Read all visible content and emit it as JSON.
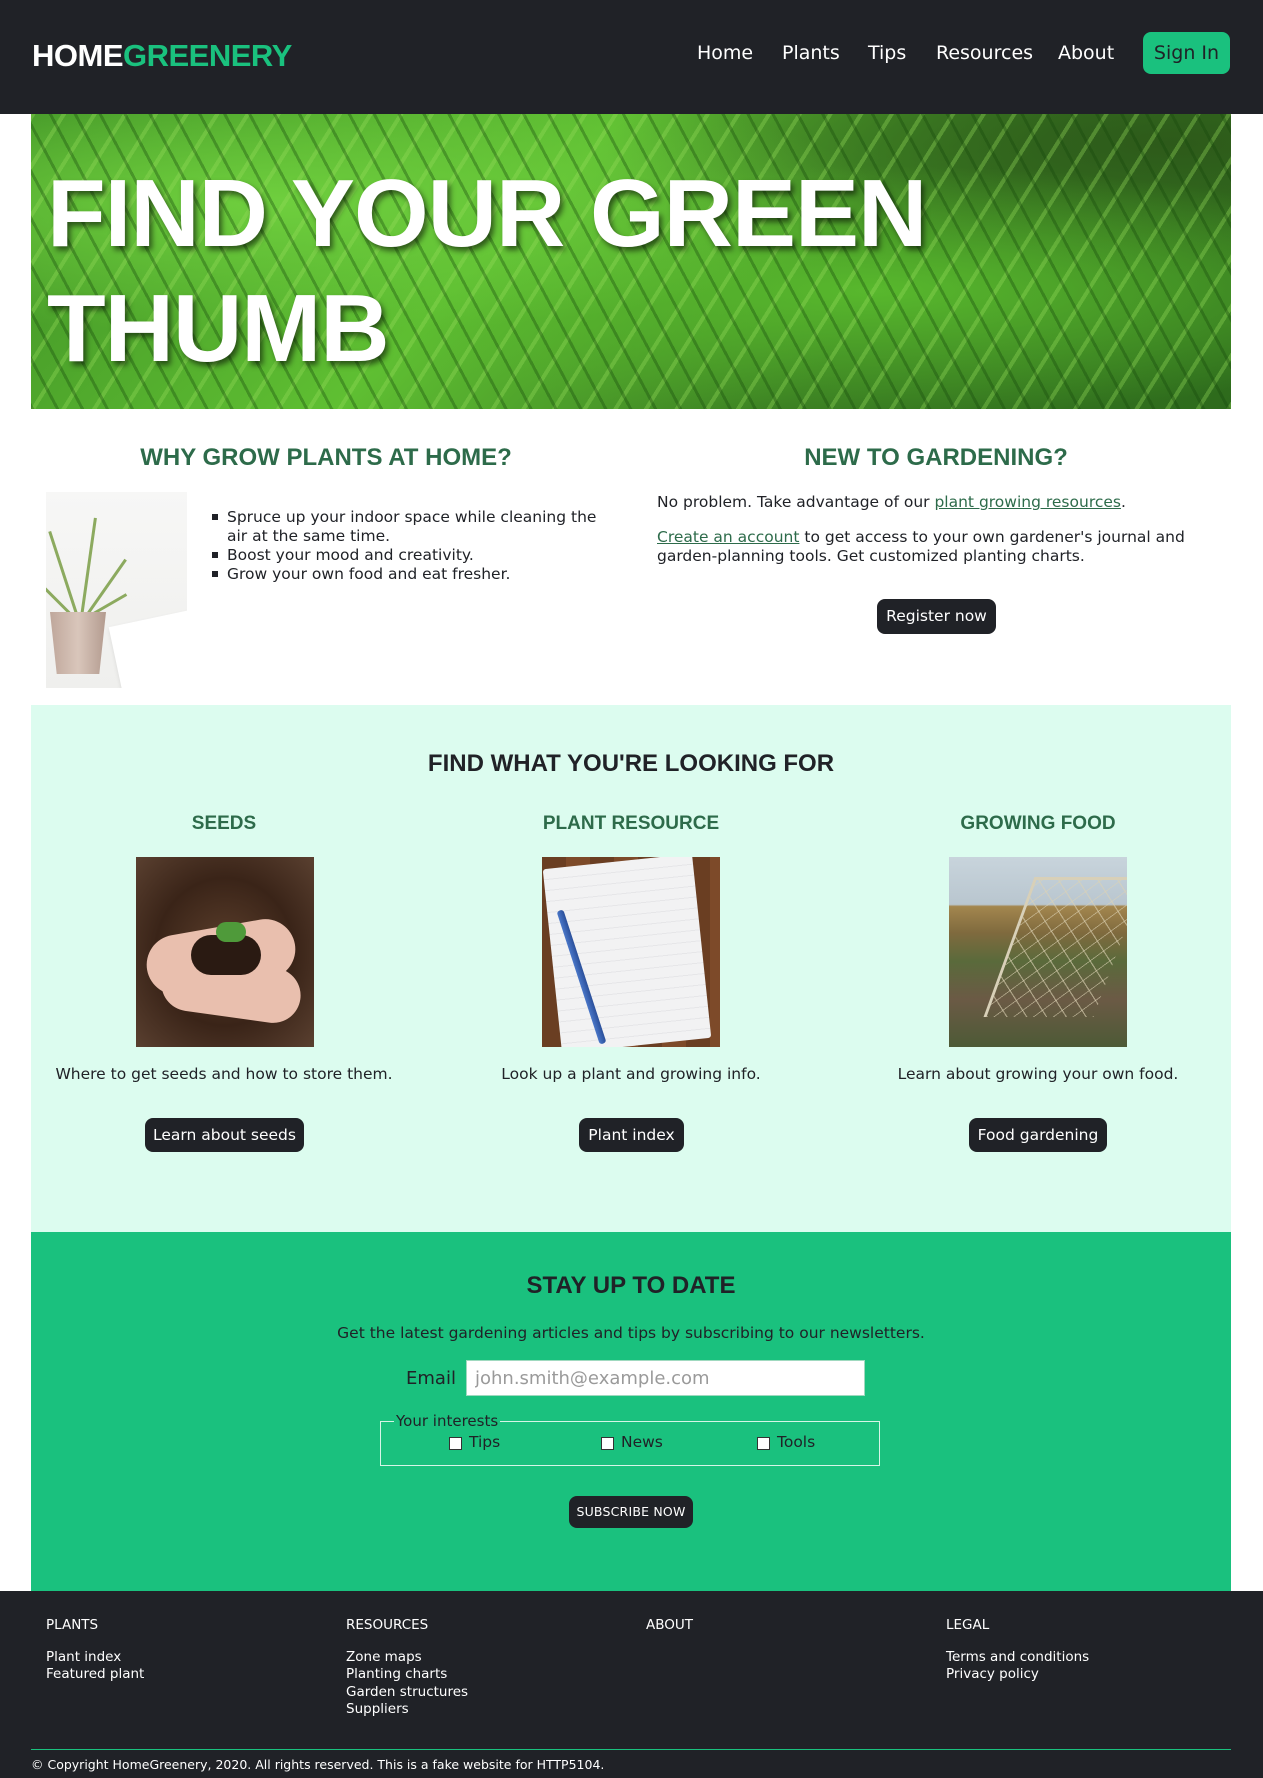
{
  "header": {
    "logo_part1": "HOME",
    "logo_part2": "GREENERY",
    "nav": [
      "Home",
      "Plants",
      "Tips",
      "Resources",
      "About"
    ],
    "sign_in": "Sign In"
  },
  "hero": {
    "line1": "FIND YOUR GREEN",
    "line2": "THUMB"
  },
  "why": {
    "title": "WHY GROW PLANTS AT HOME?",
    "items": [
      "Spruce up your indoor space while cleaning the air at the same time.",
      "Boost your mood and creativity.",
      "Grow your own food and eat fresher."
    ]
  },
  "new_to_gardening": {
    "title": "NEW TO GARDENING?",
    "p1_text": "No problem. Take advantage of our ",
    "p1_link": "plant growing resources",
    "p1_end": ".",
    "p2_link": "Create an account",
    "p2_text": " to get access to your own gardener's journal and garden-planning tools. Get customized planting charts.",
    "register": "Register now"
  },
  "find": {
    "title": "FIND WHAT YOU'RE LOOKING FOR",
    "columns": [
      {
        "title": "SEEDS",
        "text": "Where to get seeds and how to store them.",
        "button": "Learn about seeds"
      },
      {
        "title": "PLANT RESOURCE",
        "text": "Look up a plant and growing info.",
        "button": "Plant index"
      },
      {
        "title": "GROWING FOOD",
        "text": "Learn about growing your own food.",
        "button": "Food gardening"
      }
    ]
  },
  "newsletter": {
    "title": "STAY UP TO DATE",
    "subtitle": "Get the latest gardening articles and tips by subscribing to our newsletters.",
    "email_label": "Email",
    "email_placeholder": "john.smith@example.com",
    "interests_legend": "Your interests",
    "interests": [
      "Tips",
      "News",
      "Tools"
    ],
    "subscribe": "SUBSCRIBE NOW"
  },
  "footer": {
    "columns": [
      {
        "heading": "PLANTS",
        "links": [
          "Plant index",
          "Featured plant"
        ]
      },
      {
        "heading": "RESOURCES",
        "links": [
          "Zone maps",
          "Planting charts",
          "Garden structures",
          "Suppliers"
        ]
      },
      {
        "heading": "ABOUT",
        "links": []
      },
      {
        "heading": "LEGAL",
        "links": [
          "Terms and conditions",
          "Privacy policy"
        ]
      }
    ],
    "copyright": "© Copyright HomeGreenery, 2020. All rights reserved. This is a fake website for HTTP5104."
  },
  "colors": {
    "dark": "#202227",
    "accent_green": "#1ac17e",
    "heading_green": "#2d6b4a",
    "mint_bg": "#dcfcef"
  }
}
